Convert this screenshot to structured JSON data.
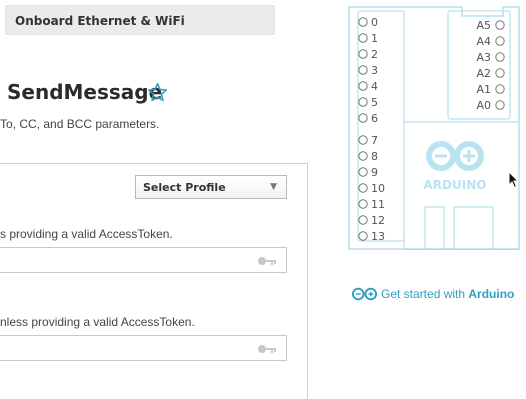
{
  "header": {
    "board_tag": "Onboard Ethernet & WiFi"
  },
  "choreo": {
    "title": "SendMessage",
    "description": "To, CC, and BCC parameters."
  },
  "form": {
    "profile_select": {
      "selected": "Select Profile"
    },
    "fields": [
      {
        "label": "s providing a valid AccessToken.",
        "value": ""
      },
      {
        "label": "nless providing a valid AccessToken.",
        "value": ""
      }
    ]
  },
  "board": {
    "digital_pins": [
      "0",
      "1",
      "2",
      "3",
      "4",
      "5",
      "6",
      "7",
      "8",
      "9",
      "10",
      "11",
      "12",
      "13"
    ],
    "analog_pins": [
      "A5",
      "A4",
      "A3",
      "A2",
      "A1",
      "A0"
    ],
    "logo_text": "ARDUINO"
  },
  "cta": {
    "prefix": "Get started with ",
    "brand": "Arduino"
  },
  "colors": {
    "accent": "#2f9fc1",
    "board_outline": "#a9d9ea",
    "logo": "#b9e3f1"
  }
}
